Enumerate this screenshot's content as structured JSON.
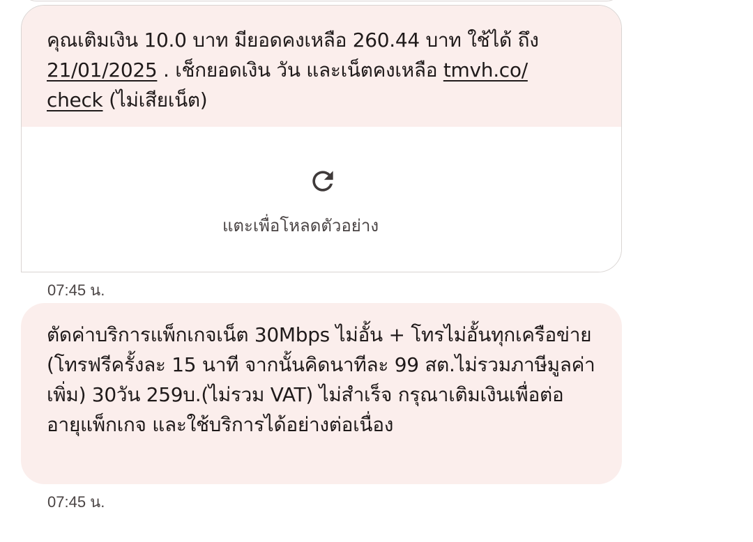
{
  "messages": [
    {
      "text_before_date": "คุณเติมเงิน 10.0 บาท มียอดคงเหลือ 260.44 บาท ใช้ได้ ถึง ",
      "date_link": "21/01/2025",
      "text_middle": " . เช็กยอดเงิน วัน และเน็ตคงเหลือ ",
      "url_link_part1": "tmvh.co/",
      "url_link_part2": "check",
      "text_after": " (ไม่เสียเน็ต)",
      "preview_label": "แตะเพื่อโหลดตัวอย่าง",
      "timestamp": "07:45 น."
    },
    {
      "text": "ตัดค่าบริการแพ็กเกจเน็ต 30Mbps ไม่อั้น + โทรไม่อั้นทุกเครือข่าย (โทรฟรีครั้งละ 15 นาที จากนั้นคิดนาทีละ 99 สต.ไม่รวมภาษีมูลค่าเพิ่ม) 30วัน 259บ.(ไม่รวม VAT) ไม่สำเร็จ กรุณาเติมเงินเพื่อต่ออายุแพ็กเกจ และใช้บริการได้อย่างต่อเนื่อง",
      "timestamp": "07:45 น."
    }
  ],
  "icons": {
    "reload": "reload-icon"
  },
  "colors": {
    "bubble": "#fbeeec",
    "border": "#d9d4d2",
    "text": "#1f1a1a",
    "muted": "#4a4444"
  }
}
